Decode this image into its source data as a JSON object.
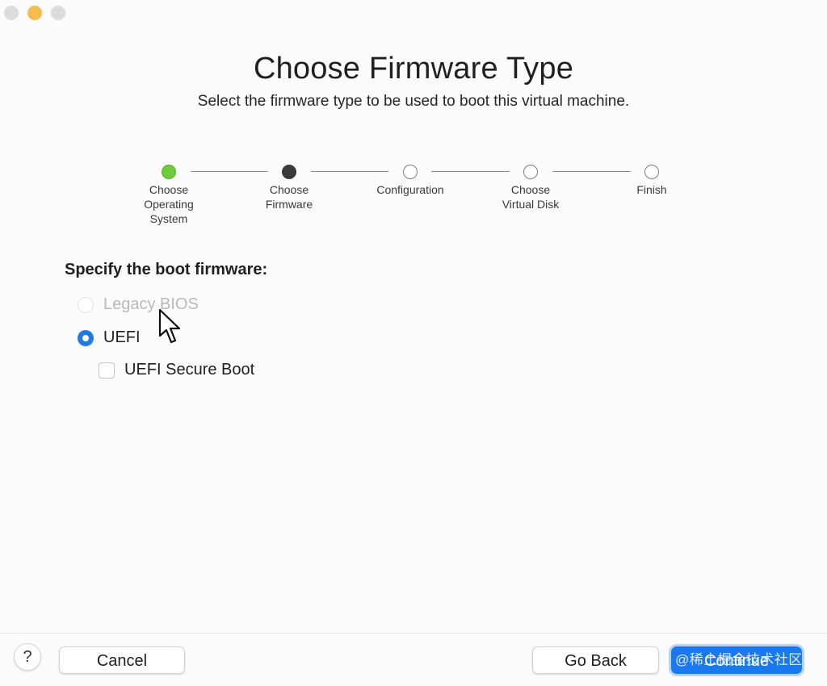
{
  "window": {
    "title": "Choose Firmware Type",
    "subtitle": "Select the firmware type to be used to boot this virtual machine."
  },
  "stepper": {
    "steps": [
      {
        "label": "Choose\nOperating\nSystem",
        "state": "done"
      },
      {
        "label": "Choose\nFirmware",
        "state": "current"
      },
      {
        "label": "Configuration",
        "state": "pending"
      },
      {
        "label": "Choose\nVirtual Disk",
        "state": "pending"
      },
      {
        "label": "Finish",
        "state": "pending"
      }
    ]
  },
  "firmware": {
    "section_label": "Specify the boot firmware:",
    "options": [
      {
        "label": "Legacy BIOS",
        "selected": false,
        "enabled": false
      },
      {
        "label": "UEFI",
        "selected": true,
        "enabled": true
      }
    ],
    "secure_boot": {
      "label": "UEFI Secure Boot",
      "checked": false
    }
  },
  "footer": {
    "help_label": "?",
    "cancel_label": "Cancel",
    "back_label": "Go Back",
    "continue_label": "Continue",
    "watermark": "@稀土掘金技术社区"
  },
  "colors": {
    "accent": "#1a78f0",
    "step_done": "#6ccc3c",
    "step_current": "#3b3b3b"
  }
}
